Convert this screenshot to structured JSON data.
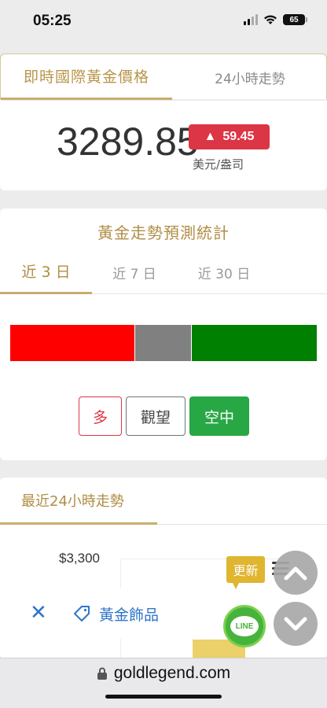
{
  "status_bar": {
    "time": "05:25",
    "battery": "65"
  },
  "price_tabs": {
    "active": "即時國際黃金價格",
    "other": "24小時走勢"
  },
  "price": {
    "value": "3289.85",
    "change": "59.45",
    "change_arrow": "▲",
    "unit": "美元/盎司"
  },
  "forecast": {
    "title": "黃金走勢預測統計",
    "tabs": [
      {
        "label": "近 3 日"
      },
      {
        "label": "近 7 日"
      },
      {
        "label": "近 30 日"
      }
    ],
    "distribution": {
      "long": 0.405,
      "wait": 0.188,
      "short": 0.407
    },
    "buttons": {
      "long": "多",
      "wait": "觀望",
      "short": "空中"
    },
    "colors": {
      "long": "#ff0000",
      "wait": "#808080",
      "short": "#008000"
    }
  },
  "trend": {
    "tab": "最近24小時走勢",
    "y_label": "$3,300"
  },
  "floating": {
    "update": "更新",
    "line": "LINE"
  },
  "overlay": {
    "tag_text": "黃金飾品"
  },
  "browser": {
    "url": "goldlegend.com"
  }
}
